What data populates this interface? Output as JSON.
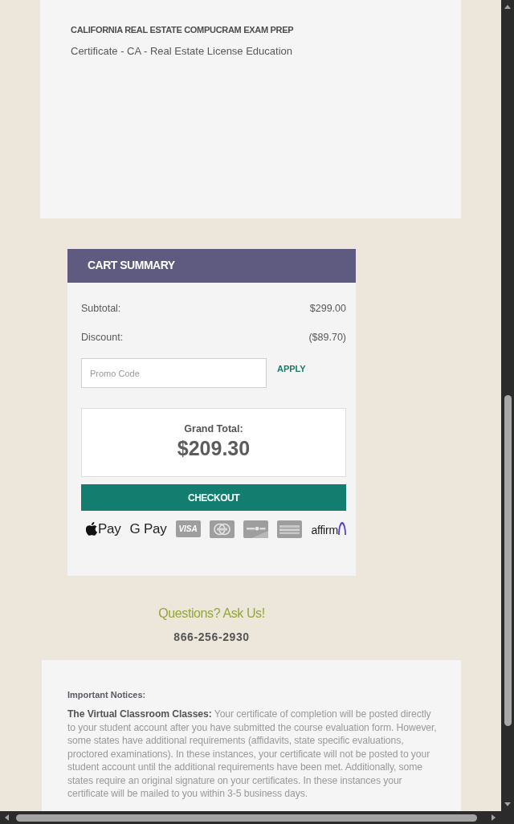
{
  "product": {
    "title": "CALIFORNIA REAL ESTATE COMPUCRAM EXAM PREP",
    "subtitle": "Certificate - CA - Real Estate License Education"
  },
  "cart_summary": {
    "title": "CART SUMMARY",
    "lines": [
      {
        "label": "Subtotal:",
        "value": "$299.00"
      },
      {
        "label": "Discount:",
        "value": "($89.70)"
      }
    ],
    "promo": {
      "placeholder": "Promo Code",
      "button": "APPLY"
    },
    "grand_total": {
      "label": "Grand Total:",
      "value": "$209.30"
    },
    "checkout_button": "CHECKOUT",
    "payment_methods": [
      {
        "kind": "apple-pay",
        "label": "Pay"
      },
      {
        "kind": "google-pay",
        "label": "G Pay"
      },
      {
        "kind": "visa",
        "label": "VISA"
      },
      {
        "kind": "mastercard"
      },
      {
        "kind": "discover"
      },
      {
        "kind": "amex"
      },
      {
        "kind": "affirm",
        "label": "affirm"
      }
    ]
  },
  "contact": {
    "heading": "Questions? Ask Us!",
    "phone": "866-256-2930"
  },
  "notices": {
    "title": "Important Notices:",
    "text": "**The Virtual Classroom Classes:** Your certificate of completion will be posted directly to your student account after you have submitted the course evaluation form. However, some states have additional requirements (affidavits, state specific evaluations, proctored examinations). In these instances, your certificate will not be posted to your student account until the additional requirements have been met. Additionally, some states require an original signature on your certificates. In these instances your certificate will be mailed to you within 3-5 business days."
  }
}
